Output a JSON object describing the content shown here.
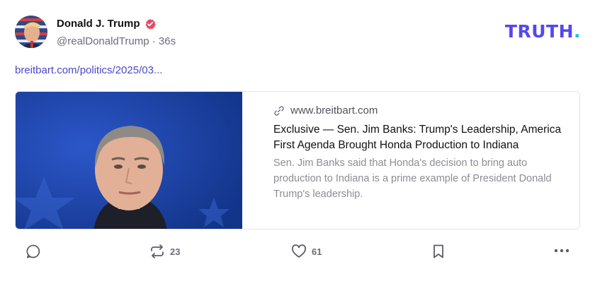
{
  "author": {
    "name": "Donald J. Trump",
    "handle": "@realDonaldTrump",
    "separator": "·",
    "time": "36s"
  },
  "brand": {
    "logo_text": "TRUTH",
    "logo_dot": "."
  },
  "post": {
    "link_text": "breitbart.com/politics/2025/03..."
  },
  "link_card": {
    "domain": "www.breitbart.com",
    "title": "Exclusive — Sen. Jim Banks: Trump's Leadership, America First Agenda Brought Honda Production to Indiana",
    "description": "Sen. Jim Banks said that Honda's decision to bring auto production to Indiana is a prime example of President Donald Trump's leadership."
  },
  "actions": {
    "retruth_count": "23",
    "like_count": "61"
  },
  "icons": [
    "avatar",
    "verified-badge-icon",
    "link-icon",
    "reply-icon",
    "retruth-icon",
    "like-icon",
    "bookmark-icon",
    "more-icon"
  ],
  "colors": {
    "brand_purple": "#5448ee",
    "brand_cyan": "#17c8d6",
    "verified": "#e74b62",
    "link": "#4b48c8"
  }
}
